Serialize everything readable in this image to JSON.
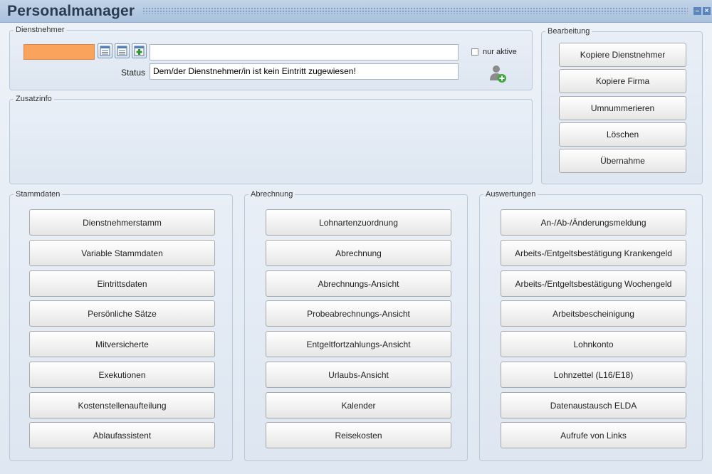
{
  "window": {
    "title": "Personalmanager"
  },
  "dienstnehmer": {
    "legend": "Dienstnehmer",
    "number_value": "",
    "name_value": "",
    "only_active_label": "nur aktive",
    "status_label": "Status",
    "status_value": "Dem/der Dienstnehmer/in ist kein Eintritt zugewiesen!"
  },
  "zusatzinfo": {
    "legend": "Zusatzinfo"
  },
  "bearbeitung": {
    "legend": "Bearbeitung",
    "buttons": [
      "Kopiere Dienstnehmer",
      "Kopiere Firma",
      "Umnummerieren",
      "Löschen",
      "Übernahme"
    ]
  },
  "stammdaten": {
    "legend": "Stammdaten",
    "buttons": [
      "Dienstnehmerstamm",
      "Variable Stammdaten",
      "Eintrittsdaten",
      "Persönliche Sätze",
      "Mitversicherte",
      "Exekutionen",
      "Kostenstellenaufteilung",
      "Ablaufassistent"
    ]
  },
  "abrechnung": {
    "legend": "Abrechnung",
    "buttons": [
      "Lohnartenzuordnung",
      "Abrechnung",
      "Abrechnungs-Ansicht",
      "Probeabrechnungs-Ansicht",
      "Entgeltfortzahlungs-Ansicht",
      "Urlaubs-Ansicht",
      "Kalender",
      "Reisekosten"
    ]
  },
  "auswertungen": {
    "legend": "Auswertungen",
    "buttons": [
      "An-/Ab-/Änderungsmeldung",
      "Arbeits-/Entgeltsbestätigung Krankengeld",
      "Arbeits-/Entgeltsbestätigung Wochengeld",
      "Arbeitsbescheinigung",
      "Lohnkonto",
      "Lohnzettel (L16/E18)",
      "Datenaustausch ELDA",
      "Aufrufe von Links"
    ]
  },
  "colors": {
    "accent_field": "#f9a35c",
    "title_bar": "#a9c1dc"
  },
  "icons": [
    "calendar-list-icon",
    "calendar-list-icon",
    "calendar-add-icon",
    "add-user-icon",
    "minimize-icon",
    "close-icon"
  ]
}
